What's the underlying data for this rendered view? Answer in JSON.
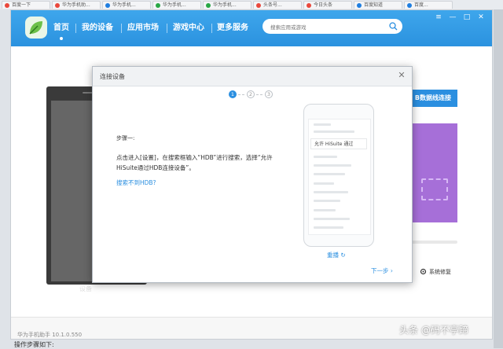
{
  "browser_tabs": [
    {
      "label": "百度一下",
      "color": "#e9483c"
    },
    {
      "label": "华为手机助...",
      "color": "#e9483c"
    },
    {
      "label": "华为手机...",
      "color": "#1f7ee0"
    },
    {
      "label": "华为手机...",
      "color": "#28a745"
    },
    {
      "label": "华为手机...",
      "color": "#28a745"
    },
    {
      "label": "头条号...",
      "color": "#e9483c"
    },
    {
      "label": "今日头条",
      "color": "#e9483c"
    },
    {
      "label": "百度知道",
      "color": "#1f7ee0"
    },
    {
      "label": "百度...",
      "color": "#1f7ee0"
    }
  ],
  "nav": [
    {
      "label": "首页"
    },
    {
      "label": "我的设备"
    },
    {
      "label": "应用市场"
    },
    {
      "label": "游戏中心"
    },
    {
      "label": "更多服务"
    }
  ],
  "search": {
    "placeholder": "搜索应用或游戏"
  },
  "window_controls": {
    "menu": "≡",
    "minimize": "—",
    "maximize": "□",
    "close": "✕"
  },
  "device": {
    "label": "设备"
  },
  "usb_button": {
    "label": "B数据线连接"
  },
  "repair": {
    "label": "系统修复"
  },
  "version": "华为手机助手 10.1.0.550",
  "modal": {
    "title": "连接设备",
    "steps": [
      "1",
      "2",
      "3"
    ],
    "active_step": 1,
    "step_title": "步骤一:",
    "description": "点击进入[设置]，在搜索框输入“HDB”进行搜索，选择“允许HiSuite通过HDB连接设备”。",
    "help_link": "搜索不到HDB?",
    "phone_highlight": "允许 HiSuite 通过",
    "replay": "重播",
    "next": "下一步"
  },
  "watermark": "头条 @码不亭蹄",
  "page_text": "操作步骤如下:",
  "colors": {
    "accent": "#2b8fe0",
    "topbar": "#3ea6ec",
    "purple": "#a66fd8"
  }
}
